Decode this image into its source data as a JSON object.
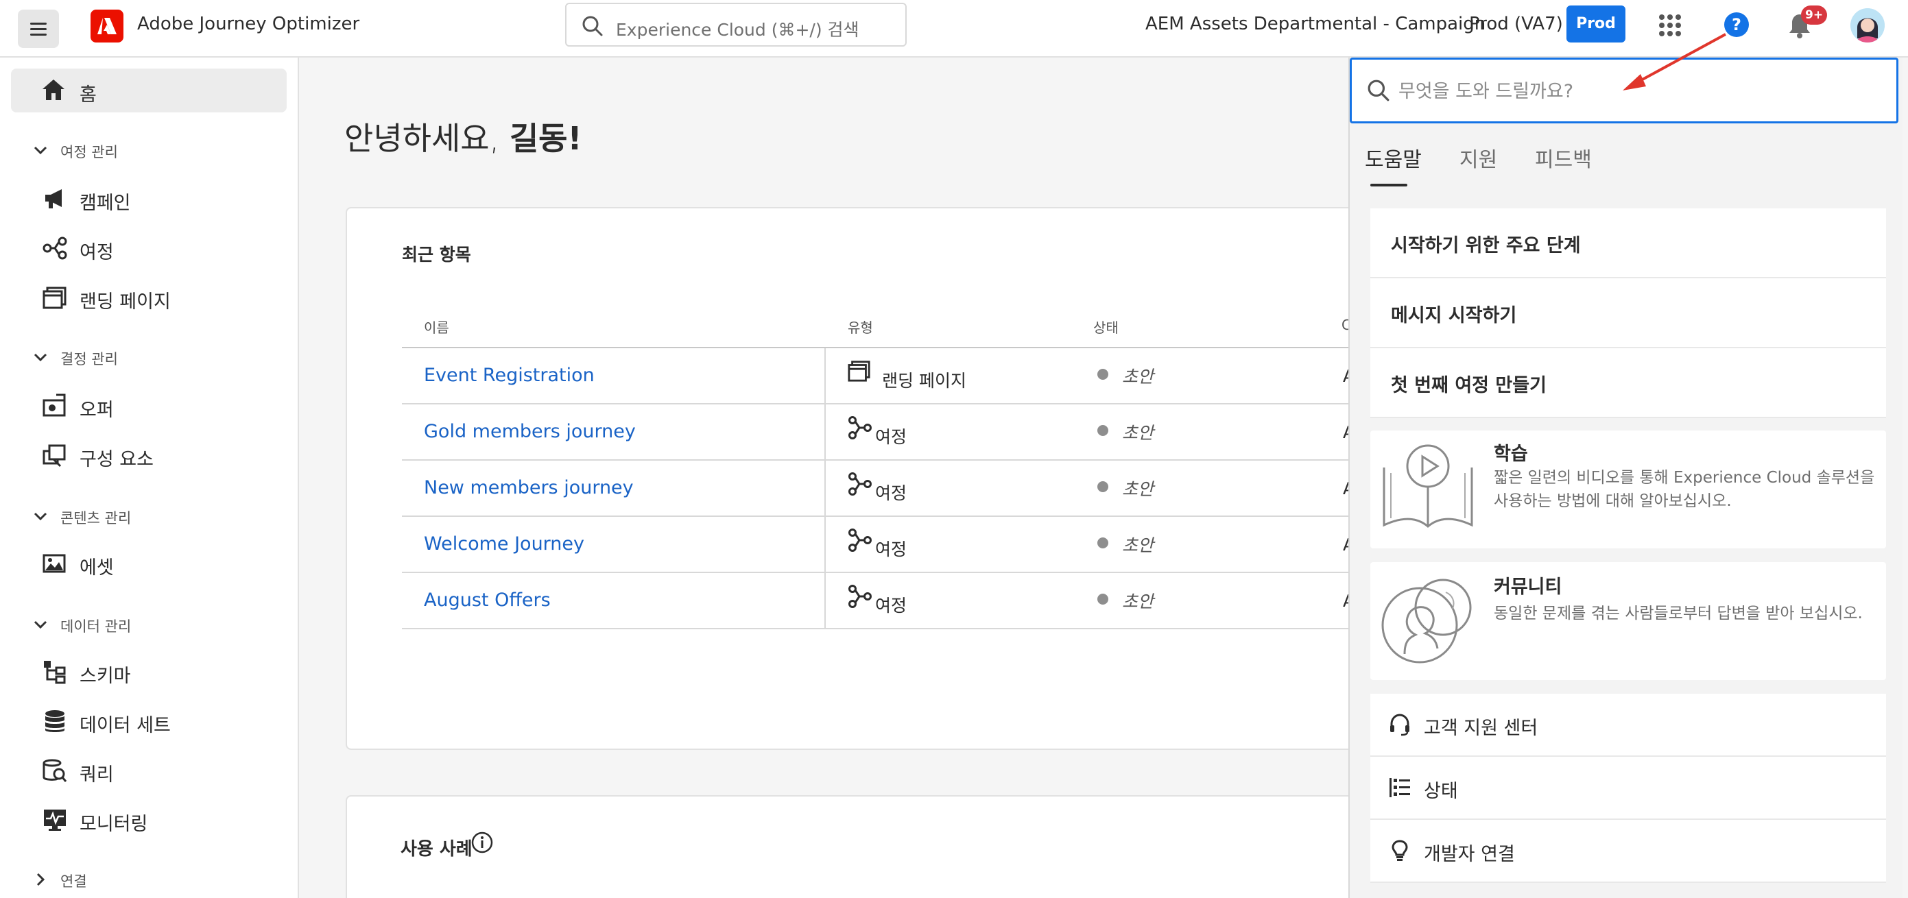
{
  "topbar": {
    "app_title": "Adobe Journey Optimizer",
    "search_placeholder": "Experience Cloud (⌘+/) 검색",
    "org_name": "AEM Assets Departmental - Campaign",
    "sandbox_name": "Prod (VA7)",
    "sandbox_badge": "Prod",
    "help_icon": "?",
    "notification_count": "9+",
    "icons": [
      "menu-icon",
      "adobe-logo",
      "search-icon",
      "apps-grid-icon",
      "help-icon",
      "bell-icon",
      "avatar"
    ]
  },
  "sidebar": {
    "home": "홈",
    "sections": [
      {
        "label": "여정 관리",
        "items": [
          "캠페인",
          "여정",
          "랜딩 페이지"
        ]
      },
      {
        "label": "결정 관리",
        "items": [
          "오퍼",
          "구성 요소"
        ]
      },
      {
        "label": "콘텐츠 관리",
        "items": [
          "에셋"
        ]
      },
      {
        "label": "데이터 관리",
        "items": [
          "스키마",
          "데이터 세트",
          "쿼리",
          "모니터링"
        ]
      },
      {
        "label": "연결",
        "items": []
      }
    ]
  },
  "main": {
    "greeting_prefix": "안녕하세요, ",
    "greeting_name": "길동!",
    "recent": {
      "title": "최근 항목",
      "columns": [
        "이름",
        "유형",
        "상태",
        "C"
      ],
      "rows": [
        {
          "name": "Event Registration",
          "type": "랜딩 페이지",
          "status": "초안",
          "extra": "A"
        },
        {
          "name": "Gold members journey",
          "type": "여정",
          "status": "초안",
          "extra": "A"
        },
        {
          "name": "New members journey",
          "type": "여정",
          "status": "초안",
          "extra": "A"
        },
        {
          "name": "Welcome Journey",
          "type": "여정",
          "status": "초안",
          "extra": "A"
        },
        {
          "name": "August Offers",
          "type": "여정",
          "status": "초안",
          "extra": "A"
        }
      ]
    },
    "use_cases_title": "사용 사례"
  },
  "help_panel": {
    "search_placeholder": "무엇을 도와 드릴까요?",
    "tabs": [
      "도움말",
      "지원",
      "피드백"
    ],
    "active_tab": "도움말",
    "links": [
      "시작하기 위한 주요 단계",
      "메시지 시작하기",
      "첫 번째 여정 만들기"
    ],
    "cards": [
      {
        "title": "학습",
        "desc": "짧은 일련의 비디오를 통해 Experience Cloud 솔루션을 사용하는 방법에 대해 알아보십시오."
      },
      {
        "title": "커뮤니티",
        "desc": "동일한 문제를 겪는 사람들로부터 답변을 받아 보십시오."
      }
    ],
    "footer_links": [
      "고객 지원 센터",
      "상태",
      "개발자 연결"
    ]
  },
  "colors": {
    "accent": "#1473e6",
    "link": "#1a63c6",
    "adobe_red": "#eb1000",
    "badge_red": "#d7373f",
    "annotation_arrow": "#e0362c"
  }
}
